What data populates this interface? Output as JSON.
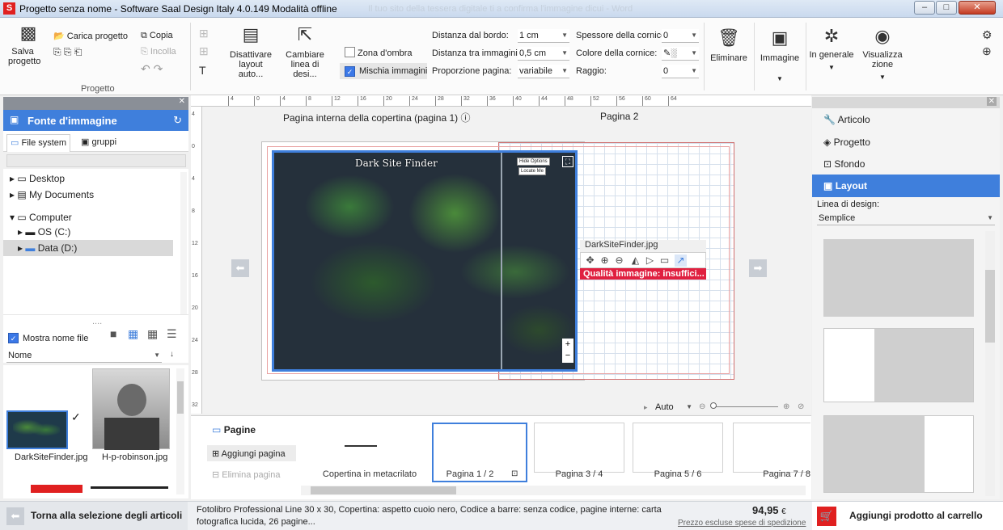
{
  "window": {
    "app_icon": "S",
    "title": "Progetto senza nome - Software Saal Design Italy 4.0.149 Modalità offline",
    "ghost_title": "Il tuo sito della tessera digitale ti a confirma l'immagine dicui - Word",
    "minimize": "–",
    "maximize": "□",
    "close": "✕"
  },
  "ribbon": {
    "save_label": "Salva progetto",
    "load_label": "Carica progetto",
    "copy_label": "Copia",
    "paste_label": "Incolla",
    "group_label": "Progetto",
    "disable_layout_label": "Disattivare layout auto...",
    "change_line_label": "Cambiare linea di desi...",
    "shadow_label": "Zona d'ombra",
    "mix_label": "Mischia immagini",
    "edge_label": "Distanza dal bordo:",
    "edge_value": "1 cm",
    "spacing_label": "Distanza tra immagini:",
    "spacing_value": "0,5 cm",
    "ratio_label": "Proporzione pagina:",
    "ratio_value": "variabile",
    "frame_thickness_label": "Spessore della cornice:",
    "frame_thickness_value": "0",
    "frame_color_label": "Colore della cornice:",
    "radius_label": "Raggio:",
    "radius_value": "0",
    "delete_label": "Eliminare",
    "image_label": "Immagine",
    "general_label": "In generale",
    "view_label": "Visualizza zione"
  },
  "left": {
    "header": "Fonte d'immagine",
    "tab_filesystem": "File system",
    "tab_groups": "gruppi",
    "tree": [
      "Desktop",
      "My Documents",
      "Computer",
      "OS (C:)",
      "Data (D:)"
    ],
    "show_names_label": "Mostra nome file",
    "sort_label": "Nome",
    "thumbs": [
      "DarkSiteFinder.jpg",
      "H-p-robinson.jpg"
    ]
  },
  "ruler": [
    "4",
    "0",
    "4",
    "8",
    "12",
    "16",
    "20",
    "24",
    "28",
    "32",
    "36",
    "40",
    "44",
    "48",
    "52",
    "56",
    "60",
    "64"
  ],
  "vruler": [
    "4",
    "0",
    "4",
    "8",
    "12",
    "16",
    "20",
    "24",
    "28",
    "32"
  ],
  "canvas": {
    "left_page_label": "Pagina interna della copertina (pagina 1)",
    "right_page_label": "Pagina 2",
    "map_title": "Dark Site Finder",
    "map_btn1": "Hide Options",
    "map_btn2": "Locate Me",
    "popup_filename": "DarkSiteFinder.jpg",
    "popup_warning": "Qualità immagine: insuffici...",
    "zoom_label": "Auto"
  },
  "pages": {
    "title": "Pagine",
    "add_label": "Aggiungi pagina",
    "delete_label": "Elimina pagina",
    "items": [
      "Copertina in metacrilato",
      "Pagina 1 / 2",
      "Pagina 3 / 4",
      "Pagina 5 / 6",
      "Pagina 7 / 8"
    ]
  },
  "right": {
    "items": [
      "Articolo",
      "Progetto",
      "Sfondo",
      "Layout"
    ],
    "design_line_label": "Linea di design:",
    "design_line_value": "Semplice"
  },
  "footer": {
    "back_label": "Torna alla selezione degli articoli",
    "description": "Fotolibro Professional Line 30 x 30, Copertina: aspetto cuoio nero, Codice a barre: senza codice, pagine interne: carta fotografica lucida, 26 pagine...",
    "price": "94,95",
    "currency": "€",
    "shipping_note": "Prezzo escluse spese di spedizione",
    "cart_label": "Aggiungi prodotto al carrello"
  },
  "colors": {
    "accent": "#3f7fdc",
    "warning": "#e02040",
    "cart": "#e02020"
  }
}
